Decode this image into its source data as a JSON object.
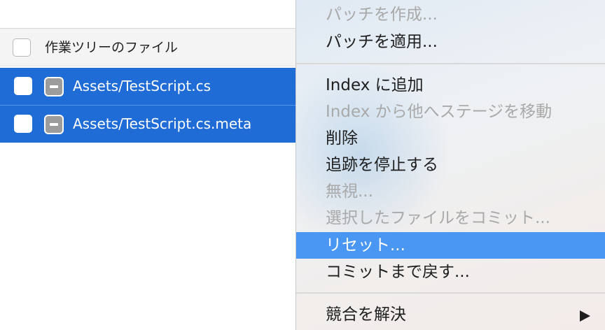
{
  "file_list": {
    "header": {
      "label": "作業ツリーのファイル"
    },
    "files": [
      {
        "name": "Assets/TestScript.cs"
      },
      {
        "name": "Assets/TestScript.cs.meta"
      }
    ]
  },
  "context_menu": {
    "items": [
      {
        "label": "パッチを作成...",
        "enabled": false
      },
      {
        "label": "パッチを適用...",
        "enabled": true
      },
      {
        "label": "Index に追加",
        "enabled": true
      },
      {
        "label": "Index から他へステージを移動",
        "enabled": false
      },
      {
        "label": "削除",
        "enabled": true
      },
      {
        "label": "追跡を停止する",
        "enabled": true
      },
      {
        "label": "無視...",
        "enabled": false
      },
      {
        "label": "選択したファイルをコミット...",
        "enabled": false
      },
      {
        "label": "リセット...",
        "enabled": true,
        "highlighted": true
      },
      {
        "label": "コミットまで戻す...",
        "enabled": true
      },
      {
        "label": "競合を解決",
        "enabled": true,
        "submenu": true,
        "submenu_icon": "chevron-right-icon"
      }
    ]
  },
  "colors": {
    "selection_blue": "#1f6cd6",
    "menu_highlight": "#4a97f3",
    "disabled_text": "#a9a9a9"
  }
}
